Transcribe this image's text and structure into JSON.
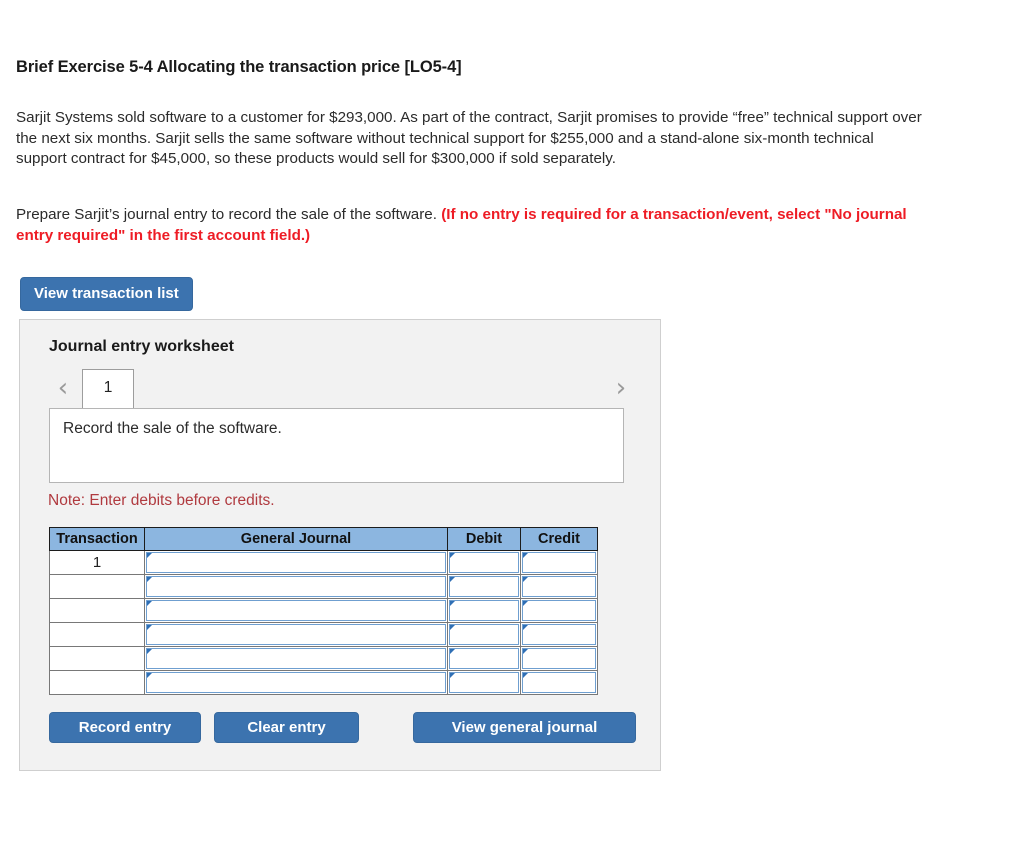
{
  "exercise": {
    "title": "Brief Exercise 5-4 Allocating the transaction price [LO5-4]",
    "problem": "Sarjit Systems sold software to a customer for $293,000. As part of the contract, Sarjit promises to provide “free” technical support over the next six months. Sarjit sells the same software without technical support for $255,000 and a stand-alone six-month technical support contract for $45,000, so these products would sell for $300,000 if sold separately.",
    "instruction_plain": "Prepare Sarjit’s journal entry to record the sale of the software. ",
    "instruction_required": "(If no entry is required for a transaction/event, select \"No journal entry required\" in the first account field.)"
  },
  "toolbar": {
    "view_transaction_list_label": "View transaction list"
  },
  "worksheet": {
    "title": "Journal entry worksheet",
    "prev_arrow": "‹",
    "next_arrow": "›",
    "active_tab": "1",
    "description": "Record the sale of the software.",
    "note": "Note: Enter debits before credits.",
    "table": {
      "headers": [
        "Transaction",
        "General Journal",
        "Debit",
        "Credit"
      ],
      "rows": [
        {
          "transaction": "1",
          "general_journal": "",
          "debit": "",
          "credit": ""
        },
        {
          "transaction": "",
          "general_journal": "",
          "debit": "",
          "credit": ""
        },
        {
          "transaction": "",
          "general_journal": "",
          "debit": "",
          "credit": ""
        },
        {
          "transaction": "",
          "general_journal": "",
          "debit": "",
          "credit": ""
        },
        {
          "transaction": "",
          "general_journal": "",
          "debit": "",
          "credit": ""
        },
        {
          "transaction": "",
          "general_journal": "",
          "debit": "",
          "credit": ""
        }
      ]
    },
    "actions": {
      "record_entry_label": "Record entry",
      "clear_entry_label": "Clear entry",
      "view_general_journal_label": "View general journal"
    }
  },
  "colors": {
    "button_blue": "#3c73af",
    "table_header_blue": "#8cb6e0",
    "instruction_red": "#ee1c25",
    "note_red": "#b03a3f",
    "panel_gray": "#f2f2f2",
    "cell_border_blue": "#6f9fd0"
  }
}
